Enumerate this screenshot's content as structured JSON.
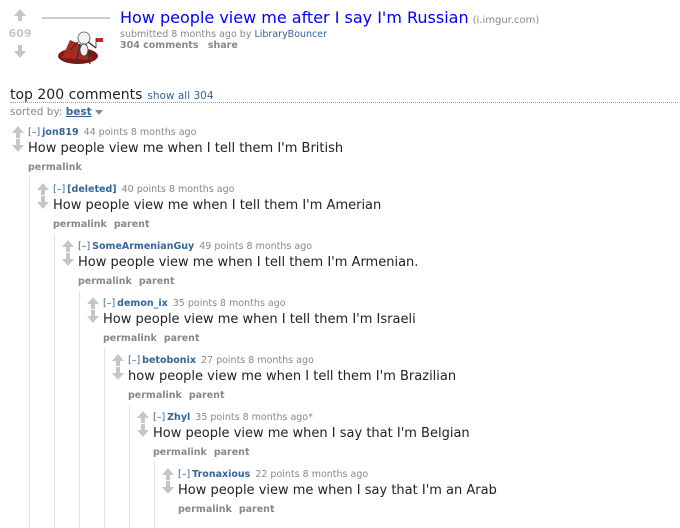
{
  "post": {
    "score": "609",
    "title": "How people view me after I say I'm Russian",
    "domain": "(i.imgur.com)",
    "tagline_prefix": "submitted 8 months ago by ",
    "author": "LibraryBouncer",
    "buttons": [
      "304 comments",
      "share"
    ]
  },
  "panel": {
    "title": "top 200 comments",
    "show_all": "show all 304",
    "sorted_label": "sorted by: ",
    "sorted_value": "best"
  },
  "comments": [
    {
      "expand": "[–]",
      "author": "jon819",
      "meta": "44 points 8 months ago",
      "body": "How people view me when I tell them I'm British",
      "buttons": [
        "permalink"
      ]
    },
    {
      "expand": "[–]",
      "author": "[deleted]",
      "meta": "40 points 8 months ago",
      "body": "How people view me when I tell them I'm Amerian",
      "buttons": [
        "permalink",
        "parent"
      ]
    },
    {
      "expand": "[–]",
      "author": "SomeArmenianGuy",
      "meta": "49 points 8 months ago",
      "body": "How people view me when I tell them I'm Armenian.",
      "buttons": [
        "permalink",
        "parent"
      ]
    },
    {
      "expand": "[–]",
      "author": "demon_ix",
      "meta": "35 points 8 months ago",
      "body": "How people view me when I tell them I'm Israeli",
      "buttons": [
        "permalink",
        "parent"
      ]
    },
    {
      "expand": "[–]",
      "author": "betobonix",
      "meta": "27 points 8 months ago",
      "body": "how people view me when I tell them I'm Brazilian",
      "buttons": [
        "permalink",
        "parent"
      ]
    },
    {
      "expand": "[–]",
      "author": "Zhyl",
      "meta": "35 points 8 months ago*",
      "body": "How people view me when I say that I'm Belgian",
      "buttons": [
        "permalink",
        "parent"
      ]
    },
    {
      "expand": "[–]",
      "author": "Tronaxious",
      "meta": "22 points 8 months ago",
      "body": "How people view me when I say that I'm an Arab",
      "buttons": [
        "permalink",
        "parent"
      ]
    }
  ]
}
